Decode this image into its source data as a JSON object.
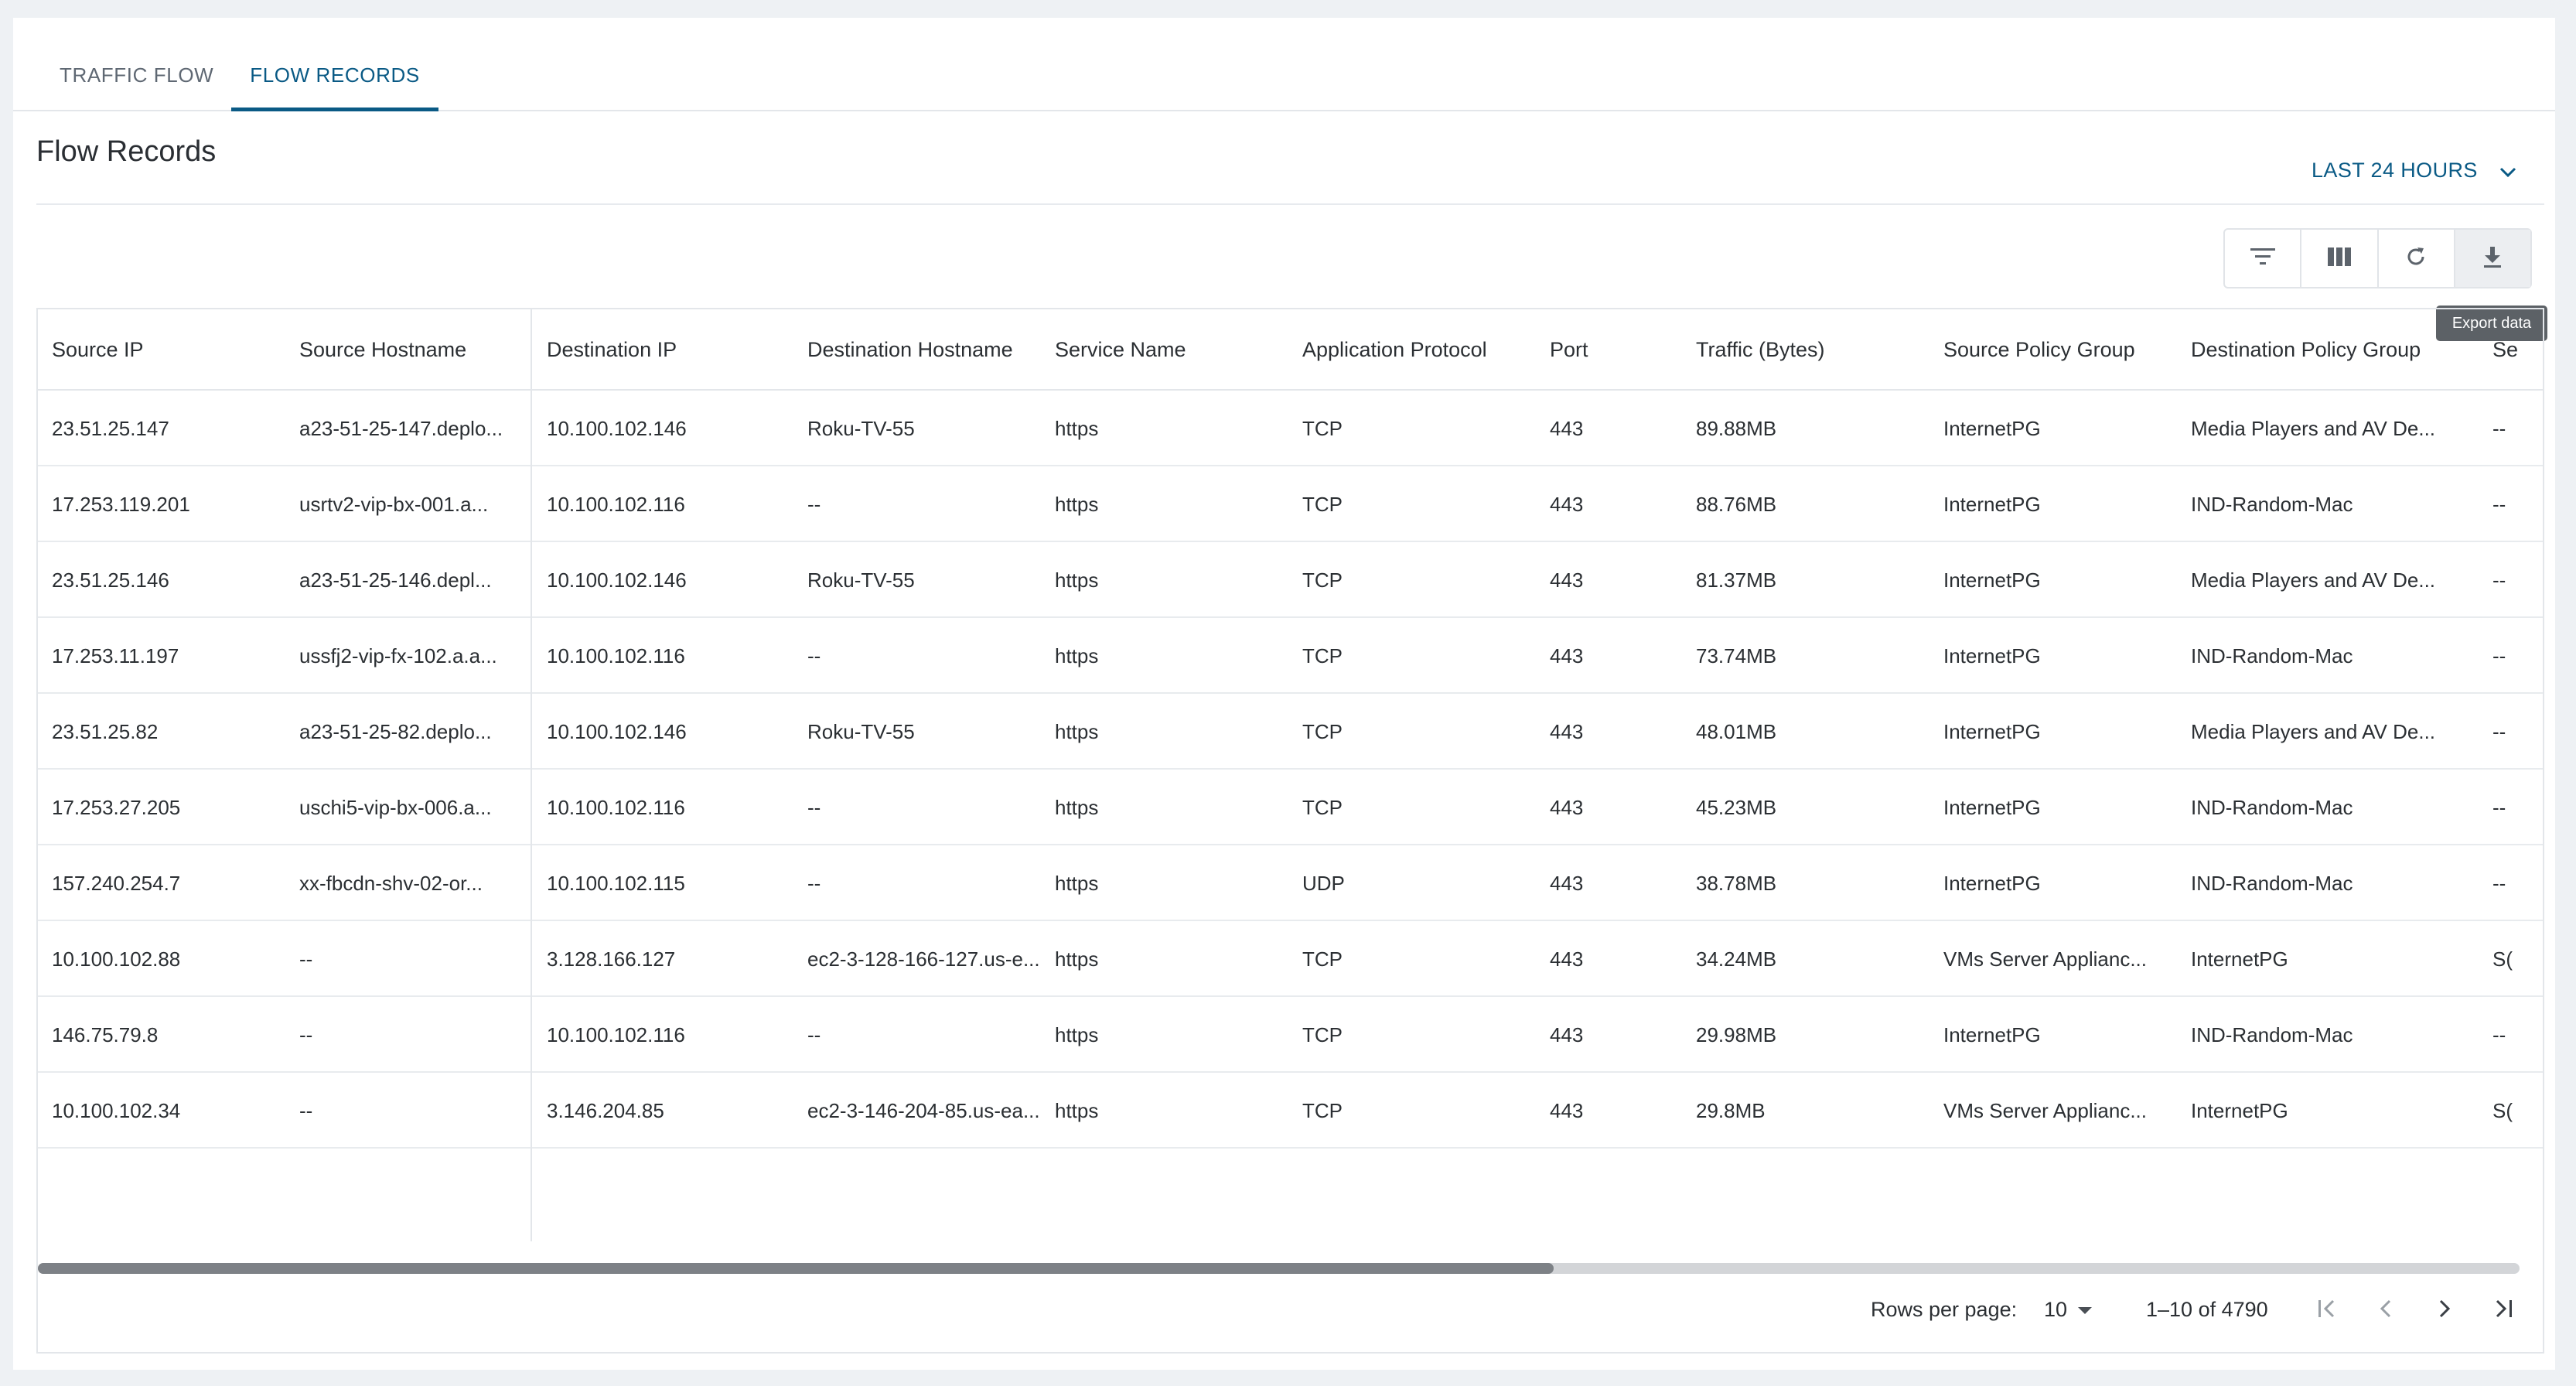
{
  "tabs": [
    {
      "label": "TRAFFIC FLOW"
    },
    {
      "label": "FLOW RECORDS",
      "active": true
    }
  ],
  "header": {
    "title": "Flow Records",
    "timerange": "LAST 24 HOURS"
  },
  "toolbar": {
    "buttons": [
      "filter-icon",
      "columns-icon",
      "refresh-icon",
      "download-icon"
    ],
    "tooltip": "Export data"
  },
  "table": {
    "columns": [
      "Source IP",
      "Source Hostname",
      "Destination IP",
      "Destination Hostname",
      "Service Name",
      "Application Protocol",
      "Port",
      "Traffic (Bytes)",
      "Source Policy Group",
      "Destination Policy Group",
      "Se"
    ],
    "rows": [
      [
        "23.51.25.147",
        "a23-51-25-147.deplo...",
        "10.100.102.146",
        "Roku-TV-55",
        "https",
        "TCP",
        "443",
        "89.88MB",
        "InternetPG",
        "Media Players and AV De...",
        "--"
      ],
      [
        "17.253.119.201",
        "usrtv2-vip-bx-001.a...",
        "10.100.102.116",
        "--",
        "https",
        "TCP",
        "443",
        "88.76MB",
        "InternetPG",
        "IND-Random-Mac",
        "--"
      ],
      [
        "23.51.25.146",
        "a23-51-25-146.depl...",
        "10.100.102.146",
        "Roku-TV-55",
        "https",
        "TCP",
        "443",
        "81.37MB",
        "InternetPG",
        "Media Players and AV De...",
        "--"
      ],
      [
        "17.253.11.197",
        "ussfj2-vip-fx-102.a.a...",
        "10.100.102.116",
        "--",
        "https",
        "TCP",
        "443",
        "73.74MB",
        "InternetPG",
        "IND-Random-Mac",
        "--"
      ],
      [
        "23.51.25.82",
        "a23-51-25-82.deplo...",
        "10.100.102.146",
        "Roku-TV-55",
        "https",
        "TCP",
        "443",
        "48.01MB",
        "InternetPG",
        "Media Players and AV De...",
        "--"
      ],
      [
        "17.253.27.205",
        "uschi5-vip-bx-006.a...",
        "10.100.102.116",
        "--",
        "https",
        "TCP",
        "443",
        "45.23MB",
        "InternetPG",
        "IND-Random-Mac",
        "--"
      ],
      [
        "157.240.254.7",
        "xx-fbcdn-shv-02-or...",
        "10.100.102.115",
        "--",
        "https",
        "UDP",
        "443",
        "38.78MB",
        "InternetPG",
        "IND-Random-Mac",
        "--"
      ],
      [
        "10.100.102.88",
        "--",
        "3.128.166.127",
        "ec2-3-128-166-127.us-e...",
        "https",
        "TCP",
        "443",
        "34.24MB",
        "VMs Server Applianc...",
        "InternetPG",
        "S("
      ],
      [
        "146.75.79.8",
        "--",
        "10.100.102.116",
        "--",
        "https",
        "TCP",
        "443",
        "29.98MB",
        "InternetPG",
        "IND-Random-Mac",
        "--"
      ],
      [
        "10.100.102.34",
        "--",
        "3.146.204.85",
        "ec2-3-146-204-85.us-ea...",
        "https",
        "TCP",
        "443",
        "29.8MB",
        "VMs Server Applianc...",
        "InternetPG",
        "S("
      ]
    ]
  },
  "pagination": {
    "rows_per_page_label": "Rows per page:",
    "rows_per_page": "10",
    "range": "1–10 of 4790"
  }
}
